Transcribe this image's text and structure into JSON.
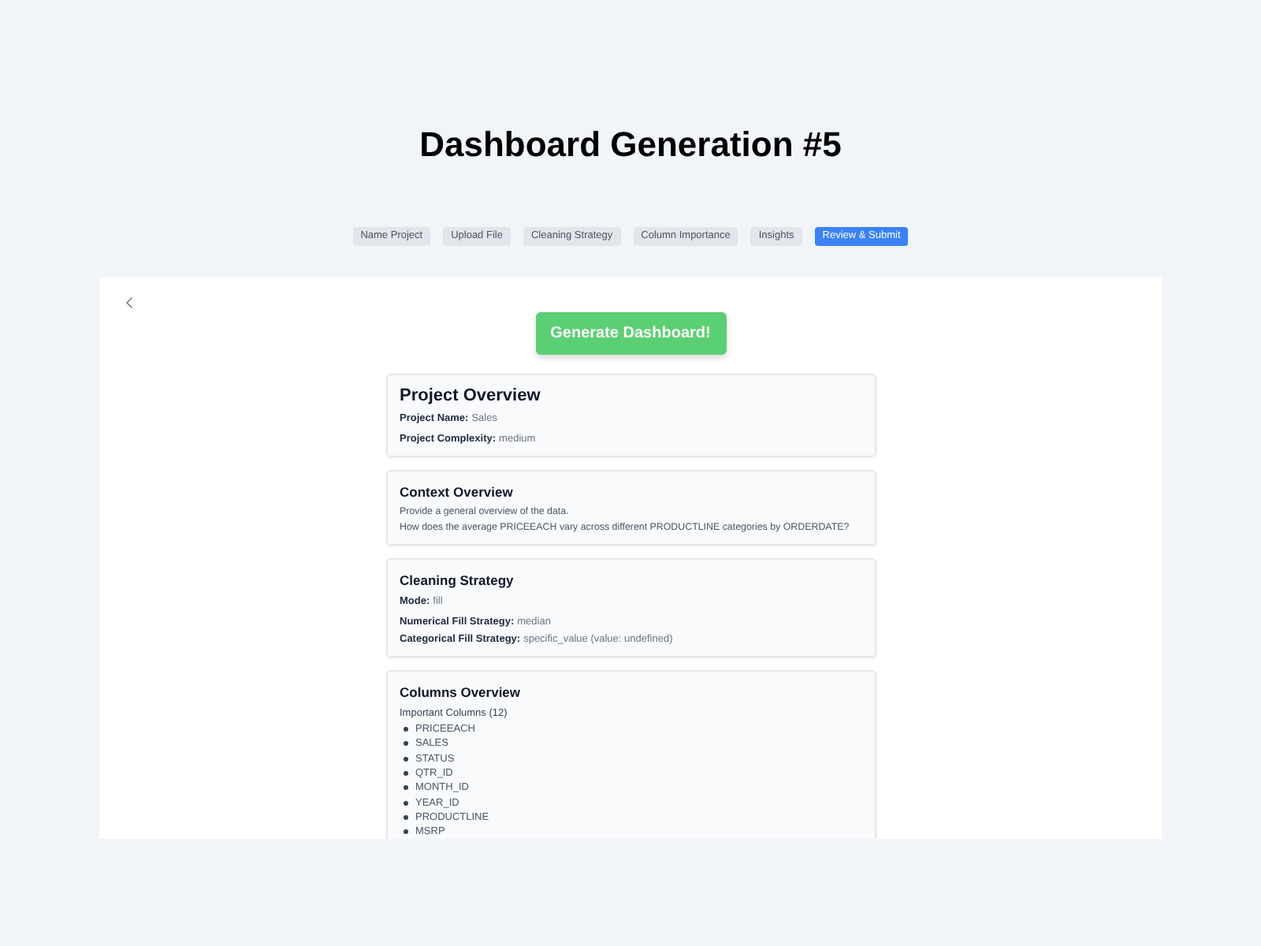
{
  "page": {
    "title": "Dashboard Generation #5"
  },
  "steps": [
    {
      "label": "Name Project",
      "selected": false
    },
    {
      "label": "Upload File",
      "selected": false
    },
    {
      "label": "Cleaning Strategy",
      "selected": false
    },
    {
      "label": "Column Importance",
      "selected": false
    },
    {
      "label": "Insights",
      "selected": false
    },
    {
      "label": "Review & Submit",
      "selected": true
    }
  ],
  "generate_button": {
    "label": "Generate Dashboard!"
  },
  "sections": [
    {
      "kind": "fields",
      "title": "Project Overview",
      "groups": [
        [
          {
            "label": "Project Name:",
            "value": "Sales"
          }
        ],
        [
          {
            "label": "Project Complexity:",
            "value": "medium"
          }
        ]
      ]
    },
    {
      "kind": "text",
      "title": "Context Overview",
      "lines": [
        "Provide a general overview of the data.",
        "How does the average PRICEEACH vary across different PRODUCTLINE categories by ORDERDATE?"
      ]
    },
    {
      "kind": "fields",
      "title": "Cleaning Strategy",
      "groups": [
        [
          {
            "label": "Mode:",
            "value": "fill"
          }
        ],
        [
          {
            "label": "Numerical Fill Strategy:",
            "value": "median"
          },
          {
            "label": "Categorical Fill Strategy:",
            "value": "specific_value (value: undefined)"
          }
        ]
      ]
    },
    {
      "kind": "list",
      "title": "Columns Overview",
      "subtitle": "Important Columns (12)",
      "items": [
        "PRICEEACH",
        "SALES",
        "STATUS",
        "QTR_ID",
        "MONTH_ID",
        "YEAR_ID",
        "PRODUCTLINE",
        "MSRP"
      ]
    }
  ]
}
